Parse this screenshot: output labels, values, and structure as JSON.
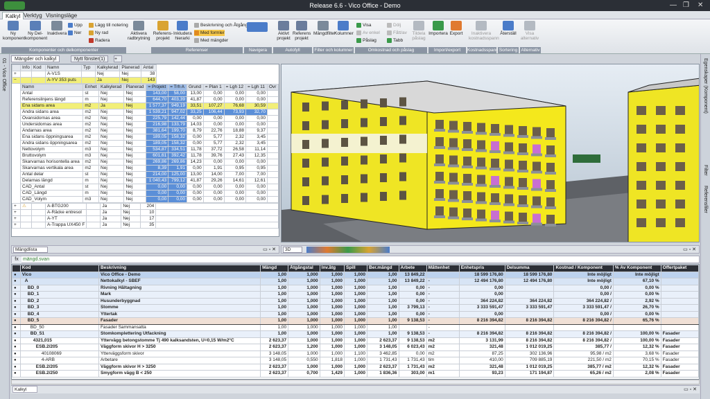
{
  "window": {
    "title": "Release 6.6 - Vico Office - Demo",
    "controls": [
      "—",
      "❐",
      "✕"
    ]
  },
  "menu": {
    "tabs": [
      "Kalkyl",
      "Verktyg",
      "Visningsläge"
    ]
  },
  "ribbon": {
    "buttons": [
      {
        "label": "Ny komponent",
        "color": "#5a7fb8"
      },
      {
        "label": "Ny Del-komponent",
        "color": "#5a7fb8"
      },
      {
        "label": "Inaktivera",
        "color": "#7b8a9a"
      },
      {
        "label": "Aktivera radbrytning",
        "color": "#7b8a9a"
      },
      {
        "label": "Referens-projekt",
        "color": "#d9a332"
      },
      {
        "label": "Inkludera hierarki",
        "color": "#4b7cc9"
      },
      {
        "label": "Aktivt projekt",
        "color": "#6b7d9c"
      },
      {
        "label": "Referens projekt",
        "color": "#6b7d9c"
      },
      {
        "label": "Mängdfilter",
        "color": "#7b8a9a"
      },
      {
        "label": "Kolumner",
        "color": "#4b7cc9"
      },
      {
        "label": "Importera",
        "color": "#3a9a4a"
      },
      {
        "label": "Export",
        "color": "#e07a30"
      },
      {
        "label": "Inaktivera kostnadsspann",
        "color": "#b4bac2"
      },
      {
        "label": "Återställ",
        "color": "#4b7cc9"
      },
      {
        "label": "Visa alternativ",
        "color": "#b4bac2"
      }
    ],
    "small": [
      "Upp",
      "Ner",
      "Lägg till notering",
      "Ny rad",
      "Radera",
      "Beskrivning och Åtgång",
      "Med formler",
      "Med mängder",
      "Visa",
      "Av enkel",
      "Påslag",
      "Dölj",
      "Fått/av",
      "Tabb",
      "Tildela påslag"
    ],
    "groups": [
      "Komponenter och delkomponenter",
      "Referenser",
      "Navigera",
      "Autofyll",
      "Filter och kolumner",
      "Omkostnad och påslag",
      "Import/export",
      "Kostnadsspann",
      "Sortering",
      "Alternativ"
    ]
  },
  "left_strip": {
    "label": "01 - Vico Office"
  },
  "right_strip": {
    "labels": [
      "Egenskaper (Komponent)",
      "Filter",
      "Referensfiler"
    ]
  },
  "doc_tabs": [
    "Mängder och kalkyl",
    "Nytt fönster(1)"
  ],
  "top_grid": {
    "headers": [
      "Info",
      "Kod",
      "Namn",
      "Typ",
      "Kalkylerad",
      "Planerad",
      "Antal"
    ],
    "top_rows": [
      {
        "kod": "",
        "namn": "A-V1S",
        "kalk": "Nej",
        "plan": "Nej",
        "antal": "38"
      },
      {
        "kod": "",
        "namn": "A-YV 353 puts",
        "kalk": "Ja",
        "plan": "Nej",
        "antal": "143"
      }
    ],
    "sub_headers": [
      "Namn",
      "Enhet",
      "Kalkylerad",
      "Planerad",
      "= Projekt",
      "= Trh A",
      "Grund",
      "= Plan 1",
      "= Lgh 12",
      "= Lgh 11",
      "Övr"
    ],
    "sub_rows": [
      [
        "Antal",
        "st",
        "Nej",
        "Nej",
        "143,00",
        "58,00",
        "13,00",
        "0,00",
        "0,00",
        "0,00"
      ],
      [
        "Referenslinjens längd",
        "m",
        "Nej",
        "Nej",
        "644,70",
        "403,39",
        "41,87",
        "0,00",
        "0,00",
        "0,00"
      ],
      [
        "Ena sidans area",
        "m2",
        "Ja",
        "Nej",
        "1 577,37",
        "949,19",
        "33,51",
        "107,27",
        "76,68",
        "30,59"
      ],
      [
        "Andra sidans area",
        "m2",
        "Nej",
        "Nej",
        "1 539,21",
        "947,02",
        "33,25",
        "106,44",
        "73,93",
        "32,70"
      ],
      [
        "Ovansidornas area",
        "m2",
        "Nej",
        "Nej",
        "225,79",
        "142,44",
        "0,00",
        "0,00",
        "0,00",
        "0,00"
      ],
      [
        "Undersidornas area",
        "m2",
        "Nej",
        "Nej",
        "216,98",
        "133,79",
        "14,03",
        "0,00",
        "0,00",
        "0,00"
      ],
      [
        "Ändarnas area",
        "m2",
        "Nej",
        "Nej",
        "381,64",
        "199,70",
        "8,79",
        "22,76",
        "18,88",
        "9,37"
      ],
      [
        "Ena sidans öppningsarea",
        "m2",
        "Nej",
        "Nej",
        "189,05",
        "158,32",
        "0,00",
        "5,77",
        "2,32",
        "3,45"
      ],
      [
        "Andra sidans öppningsarea",
        "m2",
        "Nej",
        "Nej",
        "189,05",
        "158,32",
        "0,00",
        "5,77",
        "2,32",
        "3,45"
      ],
      [
        "Nettovolym",
        "m3",
        "Nej",
        "Nej",
        "534,87",
        "334,51",
        "11,78",
        "37,72",
        "26,58",
        "11,14"
      ],
      [
        "Bruttovolym",
        "m3",
        "Nej",
        "Nej",
        "601,61",
        "392,42",
        "11,78",
        "39,76",
        "27,43",
        "12,35"
      ],
      [
        "Skarvarnas horisontella area",
        "m2",
        "Nej",
        "Nej",
        "269,86",
        "269,86",
        "14,23",
        "0,00",
        "0,00",
        "0,00"
      ],
      [
        "Skarvarnas vertikala area",
        "m2",
        "Nej",
        "Nej",
        "8,39",
        "1,91",
        "0,00",
        "1,91",
        "0,95",
        "0,95"
      ],
      [
        "Antal delar",
        "st",
        "Nej",
        "Nej",
        "214,00",
        "125,00",
        "13,00",
        "14,00",
        "7,00",
        "7,00"
      ],
      [
        "Delarnas längd",
        "m",
        "Nej",
        "Nej",
        "1 040,43",
        "799,12",
        "41,87",
        "29,26",
        "14,61",
        "12,61"
      ],
      [
        "CAD_Antal",
        "st",
        "Nej",
        "Nej",
        "0,00",
        "0,00",
        "0,00",
        "0,00",
        "0,00",
        "0,00"
      ],
      [
        "CAD_Längd",
        "m",
        "Nej",
        "Nej",
        "0,00",
        "0,00",
        "0,00",
        "0,00",
        "0,00",
        "0,00"
      ],
      [
        "CAD_Volym",
        "m3",
        "Nej",
        "Nej",
        "0,00",
        "0,00",
        "0,00",
        "0,00",
        "0,00",
        "0,00"
      ]
    ],
    "bottom_rows": [
      {
        "namn": "A-BTG200",
        "kalk": "Ja",
        "plan": "Nej",
        "antal": "204"
      },
      {
        "namn": "A-Räcke entresol",
        "kalk": "Ja",
        "plan": "Nej",
        "antal": "10"
      },
      {
        "namn": "A-YT",
        "kalk": "Ja",
        "plan": "Nej",
        "antal": "17"
      },
      {
        "namn": "A-Trappa UX450 F",
        "kalk": "Ja",
        "plan": "Nej",
        "antal": "35"
      }
    ]
  },
  "view_selectors": {
    "list": "Mängdlista",
    "view": "3D",
    "bottom": "Kalkyl"
  },
  "formula": {
    "fx": "fx",
    "value": "mängd.svan"
  },
  "bottom_grid": {
    "headers": [
      "Kod",
      "Beskrivning",
      "Mängd",
      "Åtgångstal",
      "Inv.åtg",
      "Spill",
      "Ber.mängd",
      "Arbete",
      "Måttenhet",
      "Enhetspris",
      "Delsumma",
      "Kostnad / Komponent",
      "% Av Komponent",
      "Offertpaket"
    ],
    "rows": [
      [
        "Vico",
        "Vico Office - Demo",
        "1,00",
        "1,000",
        "1,000",
        "1,000",
        "1,00",
        "13 849,22",
        "",
        "18 599 176,80",
        "18 599 176,80",
        "Inte möjligt",
        "Inte möjligt",
        ""
      ],
      [
        "A",
        "Nettokalkyl - SBEF",
        "1,00",
        "1,000",
        "1,000",
        "1,000",
        "1,00",
        "13 849,22",
        "-",
        "12 494 176,80",
        "12 494 176,80",
        "Inte möjligt",
        "67,10 %",
        ""
      ],
      [
        "BD_0",
        "Rivning Håltagning",
        "1,00",
        "1,000",
        "1,000",
        "1,000",
        "1,00",
        "0,00",
        "-",
        "0,00",
        "",
        "0,00 /",
        "0,00 %",
        ""
      ],
      [
        "BD_1",
        "Mark",
        "1,00",
        "1,000",
        "1,000",
        "1,000",
        "1,00",
        "0,00",
        "-",
        "0,00",
        "",
        "0,00 /",
        "0,00 %",
        ""
      ],
      [
        "BD_2",
        "Husunderbyggnad",
        "1,00",
        "1,000",
        "1,000",
        "1,000",
        "1,00",
        "0,00",
        "-",
        "364 224,82",
        "364 224,82",
        "364 224,82 /",
        "2,92 %",
        ""
      ],
      [
        "BD_3",
        "Stomme",
        "1,00",
        "1,000",
        "1,000",
        "1,000",
        "1,00",
        "3 799,13",
        "-",
        "3 333 591,47",
        "3 333 591,47",
        "3 333 591,47 /",
        "26,70 %",
        ""
      ],
      [
        "BD_4",
        "Yttertak",
        "1,00",
        "1,000",
        "1,000",
        "1,000",
        "1,00",
        "0,00",
        "-",
        "0,00",
        "",
        "0,00 /",
        "0,00 %",
        ""
      ],
      [
        "BD_5",
        "Fasader",
        "1,00",
        "1,000",
        "1,000",
        "1,000",
        "1,00",
        "9 138,53",
        "-",
        "8 216 394,82",
        "8 216 394,82",
        "8 216 394,82 /",
        "65,76 %",
        ""
      ],
      [
        "BD_50",
        "Fasader Sammansatta",
        "1,00",
        "1,000",
        "1,000",
        "1,000",
        "1,00",
        "",
        "-",
        "",
        "",
        "",
        "",
        ""
      ],
      [
        "BD_51",
        "Stomkomplettering Utfackning",
        "1,00",
        "1,000",
        "1,000",
        "1,000",
        "1,00",
        "9 138,53",
        "-",
        "8 216 394,82",
        "8 216 394,82",
        "8 216 394,82 /",
        "100,00 %",
        "Fasader"
      ],
      [
        "4321,015",
        "Yttervägg betongstomme Tj 490 kalksandsten, U=0,15 W/m2°C",
        "2 623,37",
        "1,000",
        "1,000",
        "1,000",
        "2 623,37",
        "9 138,53",
        "m2",
        "3 131,99",
        "8 216 394,82",
        "8 216 394,82 /",
        "100,00 %",
        "Fasader"
      ],
      [
        "ESB.2/205",
        "Väggform skivor H > 3250",
        "2 623,37",
        "1,200",
        "1,000",
        "1,000",
        "3 148,05",
        "6 023,43",
        "m2",
        "321,48",
        "1 012 019,25",
        "385,77 /",
        "12,32 %",
        "Fasader"
      ],
      [
        "40108069",
        "Ytterväggsform skivor",
        "3 148,05",
        "1,000",
        "1,000",
        "1,100",
        "3 462,85",
        "0,00",
        "m2",
        "87,25",
        "302 136,96",
        "95,98 / m2",
        "3,68 %",
        "Fasader"
      ],
      [
        "4-ARB",
        "Arbetare",
        "3 148,05",
        "0,550",
        "1,818",
        "1,000",
        "1 731,43",
        "1 731,43",
        "tim",
        "410,00",
        "709 885,19",
        "221,50 / m2",
        "70,15 %",
        "Fasader"
      ],
      [
        "ESB.2/205",
        "Väggform skivor H > 3250",
        "2 623,37",
        "1,000",
        "1,000",
        "1,000",
        "2 623,37",
        "1 731,43",
        "m2",
        "321,48",
        "1 012 019,25",
        "385,77 / m2",
        "12,32 %",
        "Fasader"
      ],
      [
        "ESB.2/250",
        "Smygform vägg B < 250",
        "2 623,37",
        "0,700",
        "1,429",
        "1,000",
        "1 836,36",
        "303,00",
        "m1",
        "93,23",
        "171 194,87",
        "65,26 / m2",
        "2,08 %",
        "Fasader"
      ]
    ]
  },
  "colors": {
    "yellow": "#f2ef79",
    "blue": "#5b8fd8",
    "facade": "#f4e81c",
    "grid_header": "#2c2f36"
  }
}
